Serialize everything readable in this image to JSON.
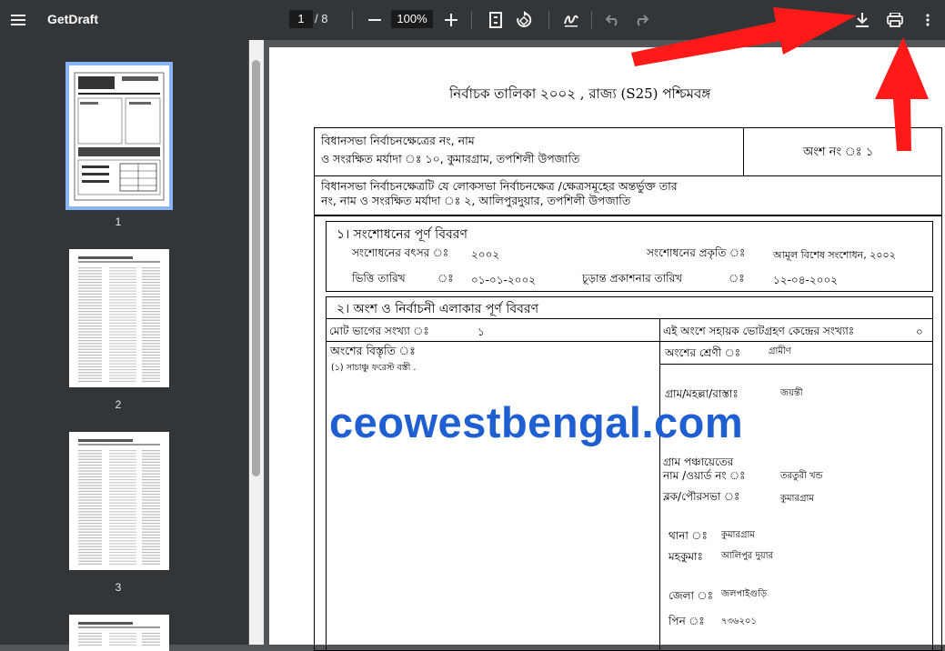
{
  "toolbar": {
    "title": "GetDraft",
    "current_page": "1",
    "total_pages": "/  8",
    "zoom": "100%"
  },
  "sidebar": {
    "thumbnails": [
      {
        "label": "1",
        "selected": true
      },
      {
        "label": "2",
        "selected": false
      },
      {
        "label": "3",
        "selected": false
      }
    ]
  },
  "document": {
    "title": "নির্বাচক তালিকা   ২০০২ , রাজ্য (S25) পশ্চিমবঙ্গ",
    "header": {
      "constituency_line1": "বিধানসভা নির্বাচনক্ষেত্রের নং, নাম",
      "constituency_line2": "ও সংরক্ষিত মর্যাদা ঃ      ১০, কুমারগ্রাম, তপশিলী উপজাতি",
      "part_label": "অংশ নং ঃ   ১",
      "lok_line1": "বিধানসভা নির্বাচনক্ষেত্রটি যে লোকসভা নির্বাচনক্ষেত্র /ক্ষেত্রসমূহের অন্তর্ভুক্ত তার",
      "lok_line2": "নং, নাম  ও সংরক্ষিত মর্যাদা ঃ      ২, আলিপুরদুয়ার, তপশিলী উপজাতি"
    },
    "section1": {
      "heading": "১। সংশোধনের পূর্ণ বিবরণ",
      "year_label": "সংশোধনের বৎসর ঃ",
      "year_value": "২০০২",
      "nature_label": "সংশোধনের প্রকৃতি ঃ",
      "nature_value": "আমূল বিশেষ সংশোধন, ২০০২",
      "base_label": "ভিত্তি তারিখ",
      "base_colon": "ঃ",
      "base_value": "০১-০১-২০০২",
      "final_label": "চূড়ান্ত প্রকাশনার তারিখ",
      "final_colon": "ঃ",
      "final_value": "১২-০৪-২০০২"
    },
    "section2": {
      "heading": "২। অংশ ও নির্বাচনী এলাকার পূর্ণ বিবরণ",
      "total_parts_label": "মোট ভাগের সংখ্যা ঃ",
      "total_parts_value": "১",
      "aux_label": "এই অংশে সহায়ক ভোটগ্রহণ কেন্দ্রের সংখ্যাঃ",
      "aux_value": "০",
      "extent_label": "অংশের বিস্তৃতি  ঃ",
      "extent_value": "(১) সাচাঞ্চু ফরেস্ট বস্তী .",
      "category_label": "অংশের শ্রেণী ঃ",
      "category_value": "গ্রামীণ",
      "village_label": "গ্রাম/মহল্লা/রাস্তাঃ",
      "village_value": "জয়ন্তী",
      "gp_label1": "গ্রাম পঞ্চায়েতের",
      "gp_label2": "নাম /ওয়ার্ড নং  ঃ",
      "gp_value": "তরতুরী খন্ড",
      "block_label": "ব্লক/পৌরসভা   ঃ",
      "block_value": "কুমারগ্রাম",
      "thana_label": "থানা  ঃ",
      "thana_value": "কুমারগ্রাম",
      "subdiv_label": "মহকুমাঃ",
      "subdiv_value": "আলিপুর দুয়ার",
      "district_label": "জেলা  ঃ",
      "district_value": "জলপাইগুড়ি",
      "pin_label": "পিন  ঃ",
      "pin_value": "৭৩৬২০১"
    }
  },
  "watermark": "ceowestbengal.com",
  "colors": {
    "toolbar_bg": "#323639",
    "viewer_bg": "#525659",
    "watermark": "#1f5fd1",
    "arrow": "#ff1a1a",
    "selection": "#8ab4f8"
  },
  "icons": [
    "menu-icon",
    "zoom-out-icon",
    "zoom-in-icon",
    "fit-page-icon",
    "rotate-icon",
    "annotate-icon",
    "undo-icon",
    "redo-icon",
    "download-icon",
    "print-icon",
    "more-vert-icon"
  ]
}
